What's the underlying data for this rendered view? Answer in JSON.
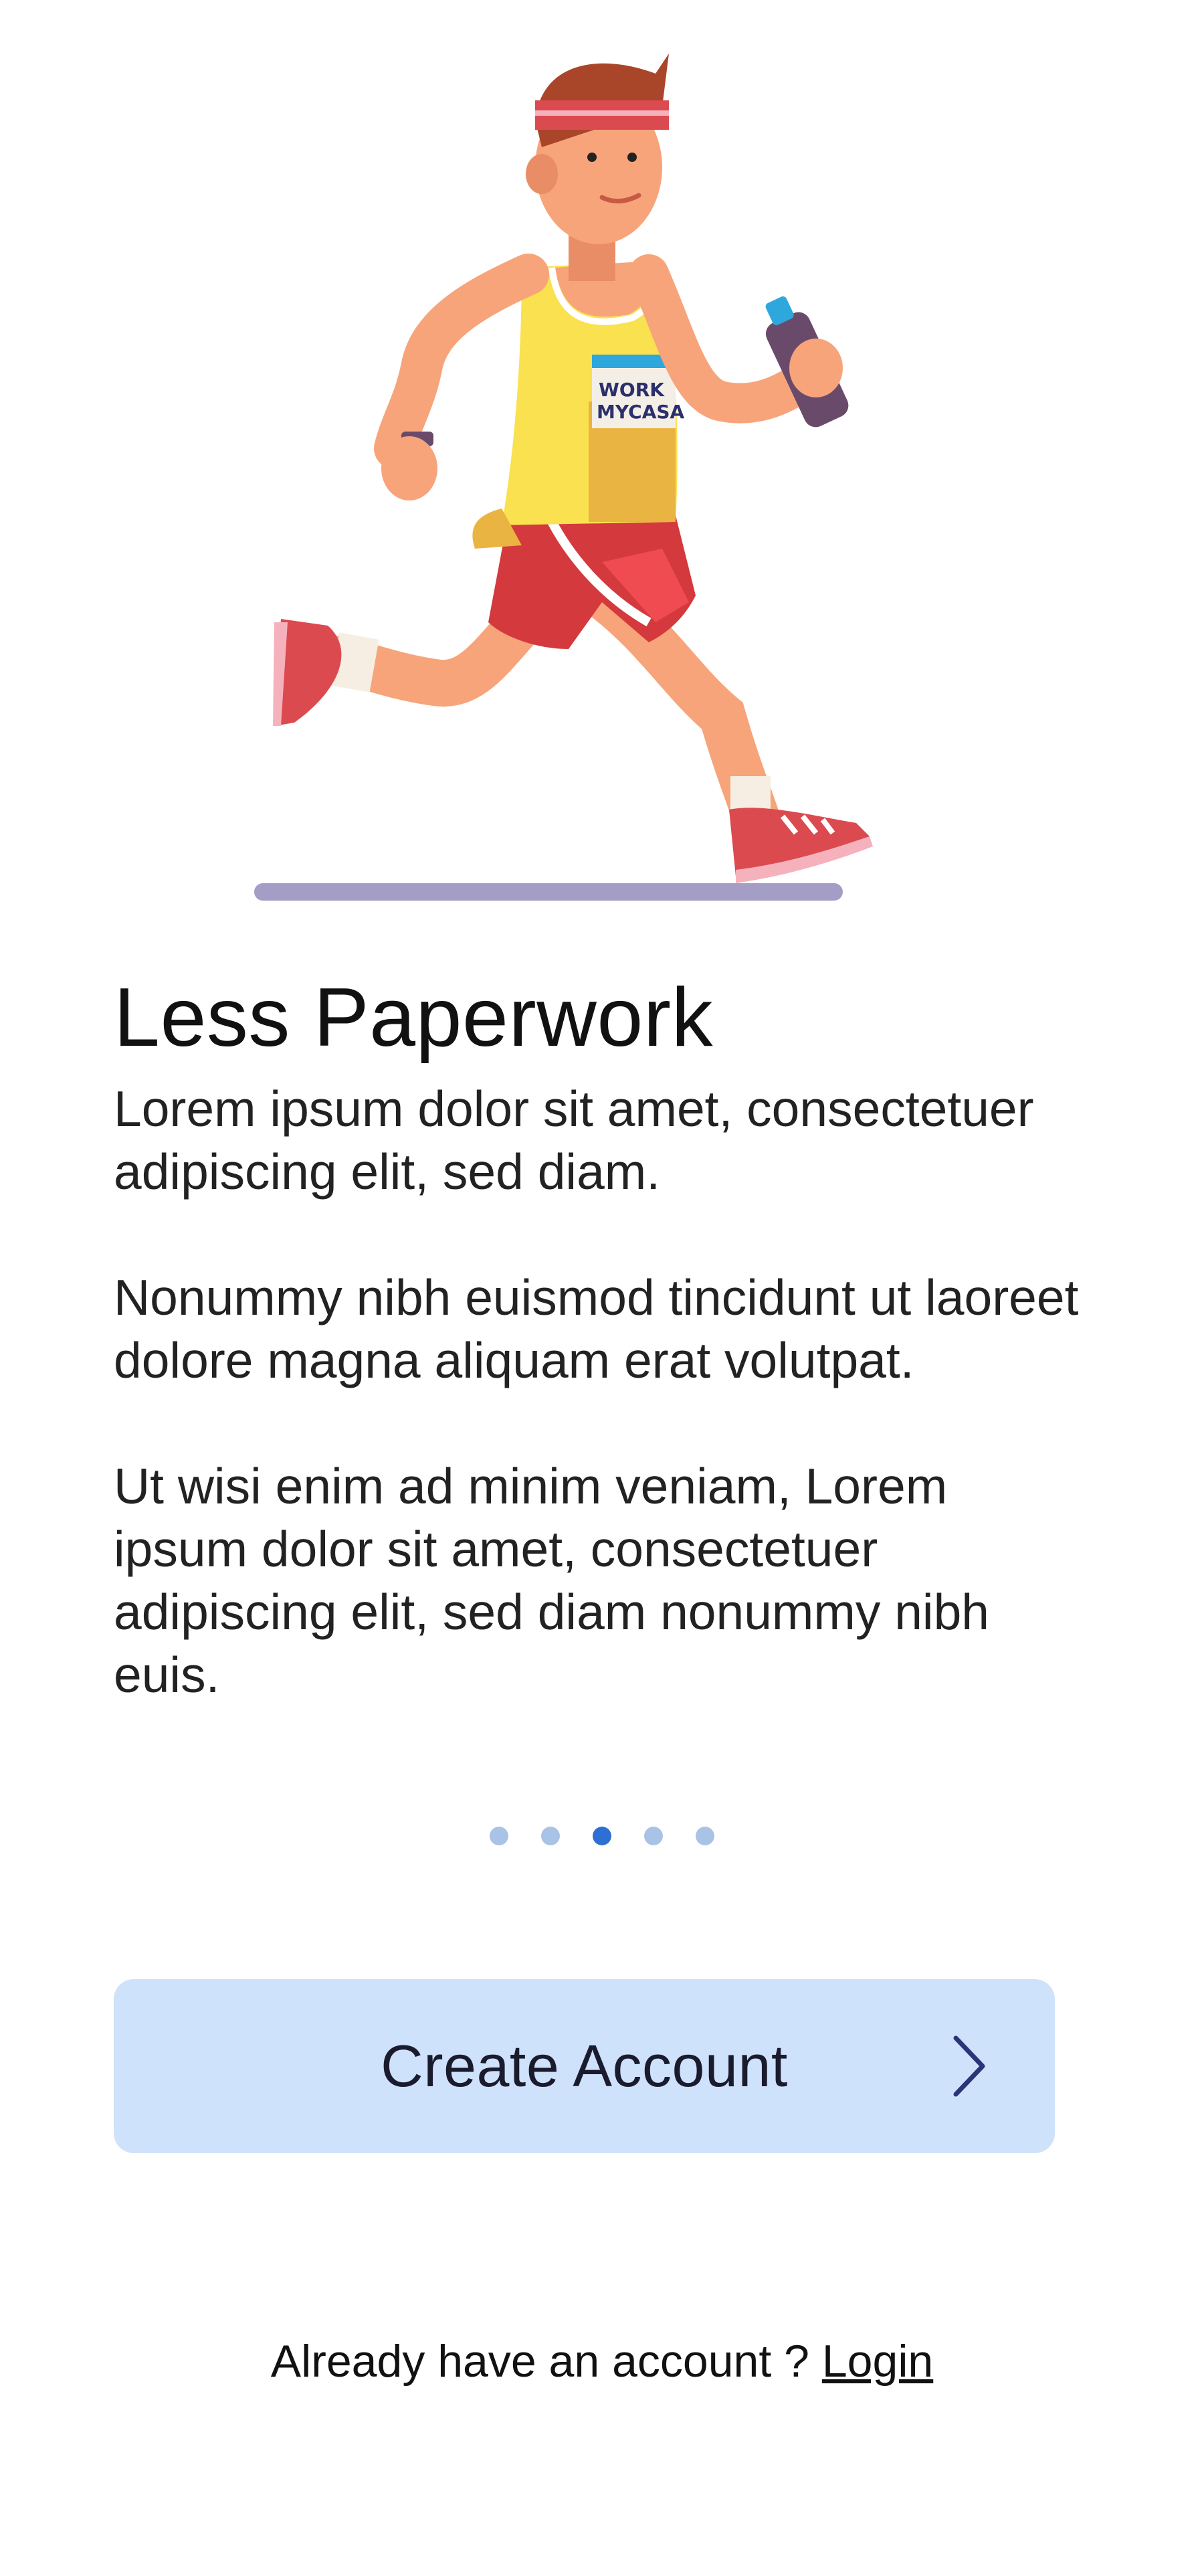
{
  "onboarding": {
    "title": "Less Paperwork",
    "paragraphs": [
      "Lorem ipsum dolor sit amet, consectetuer adipiscing elit, sed diam.",
      "Nonummy nibh euismod tincidunt ut laoreet dolore magna aliquam erat volutpat.",
      "Ut wisi enim ad minim veniam, Lorem ipsum dolor sit amet, consectetuer adipiscing elit, sed diam nonummy nibh euis."
    ],
    "bib_text_line1": "WORK",
    "bib_text_line2": "MYCASA"
  },
  "pager": {
    "total": 5,
    "active_index": 3,
    "colors": {
      "active": "#2d6fd3",
      "inactive": "#a9c3e6"
    }
  },
  "actions": {
    "create_account_label": "Create Account",
    "create_account_icon": "chevron-right-icon",
    "login_prompt": "Already have an account ? ",
    "login_label": "Login"
  },
  "colors": {
    "button_background": "#cfe2fb",
    "ground_line": "#a49dc6"
  }
}
